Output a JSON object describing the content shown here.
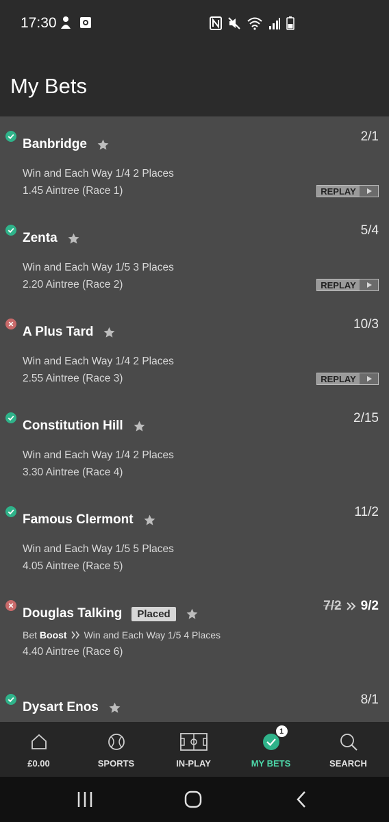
{
  "status_bar": {
    "time": "17:30"
  },
  "header": {
    "title": "My Bets"
  },
  "bets": [
    {
      "name": "Banbridge",
      "odds": "2/1",
      "result": "won",
      "market": "Win and Each Way 1/4 2 Places",
      "race": "1.45 Aintree (Race 1)",
      "replay": "REPLAY"
    },
    {
      "name": "Zenta",
      "odds": "5/4",
      "result": "won",
      "market": "Win and Each Way 1/5 3 Places",
      "race": "2.20 Aintree (Race 2)",
      "replay": "REPLAY"
    },
    {
      "name": "A Plus Tard",
      "odds": "10/3",
      "result": "lost",
      "market": "Win and Each Way 1/4 2 Places",
      "race": "2.55 Aintree (Race 3)",
      "replay": "REPLAY"
    },
    {
      "name": "Constitution Hill",
      "odds": "2/15",
      "result": "won",
      "market": "Win and Each Way 1/4 2 Places",
      "race": "3.30 Aintree (Race 4)"
    },
    {
      "name": "Famous Clermont",
      "odds": "11/2",
      "result": "won",
      "market": "Win and Each Way 1/5 5 Places",
      "race": "4.05 Aintree (Race 5)"
    },
    {
      "name": "Douglas Talking",
      "badge": "Placed",
      "old_odds": "7/2",
      "odds": "9/2",
      "result": "lost",
      "boost_prefix": "Bet",
      "boost_word": "Boost",
      "market": "Win and Each Way 1/5 4 Places",
      "race": "4.40 Aintree (Race 6)"
    },
    {
      "name": "Dysart Enos",
      "odds": "8/1",
      "result": "won"
    }
  ],
  "bottom_nav": {
    "items": [
      {
        "label": "£0.00",
        "icon": "home-icon"
      },
      {
        "label": "SPORTS",
        "icon": "tennis-ball-icon"
      },
      {
        "label": "IN-PLAY",
        "icon": "pitch-icon"
      },
      {
        "label": "MY BETS",
        "icon": "check-circle-icon",
        "badge": "1",
        "active": true
      },
      {
        "label": "SEARCH",
        "icon": "search-icon"
      }
    ]
  },
  "colors": {
    "won": "#2fb38a",
    "lost": "#c96a6a",
    "active_nav": "#4dd6a8"
  }
}
